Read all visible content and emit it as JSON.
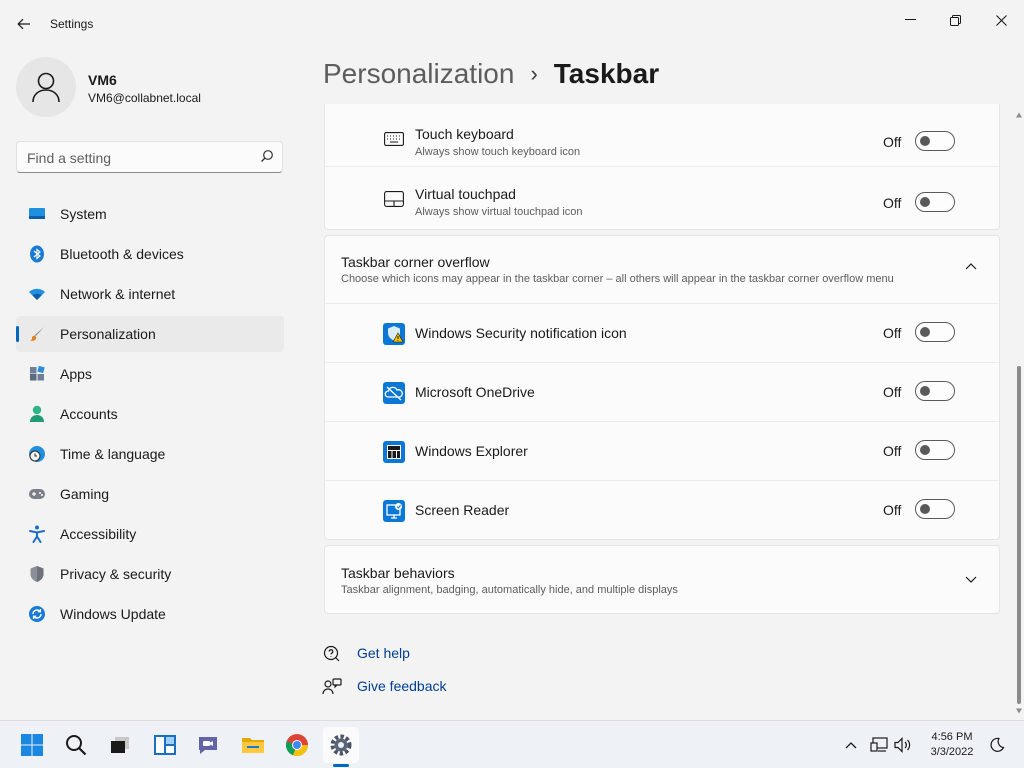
{
  "window": {
    "app_title": "Settings",
    "controls": [
      "minimize",
      "restore",
      "close"
    ]
  },
  "profile": {
    "name": "VM6",
    "email": "VM6@collabnet.local"
  },
  "search": {
    "placeholder": "Find a setting"
  },
  "sidebar": {
    "items": [
      {
        "label": "System",
        "icon": "system-icon"
      },
      {
        "label": "Bluetooth & devices",
        "icon": "bluetooth-icon"
      },
      {
        "label": "Network & internet",
        "icon": "wifi-icon"
      },
      {
        "label": "Personalization",
        "icon": "brush-icon",
        "active": true
      },
      {
        "label": "Apps",
        "icon": "apps-icon"
      },
      {
        "label": "Accounts",
        "icon": "accounts-icon"
      },
      {
        "label": "Time & language",
        "icon": "clock-globe-icon"
      },
      {
        "label": "Gaming",
        "icon": "gamepad-icon"
      },
      {
        "label": "Accessibility",
        "icon": "accessibility-icon"
      },
      {
        "label": "Privacy & security",
        "icon": "shield-icon"
      },
      {
        "label": "Windows Update",
        "icon": "update-icon"
      }
    ]
  },
  "header": {
    "parent": "Personalization",
    "separator": "›",
    "current": "Taskbar"
  },
  "pen_rows": [
    {
      "title": "Touch keyboard",
      "subtitle": "Always show touch keyboard icon",
      "state": "Off"
    },
    {
      "title": "Virtual touchpad",
      "subtitle": "Always show virtual touchpad icon",
      "state": "Off"
    }
  ],
  "overflow": {
    "title": "Taskbar corner overflow",
    "subtitle": "Choose which icons may appear in the taskbar corner – all others will appear in the taskbar corner overflow menu",
    "expanded": true,
    "rows": [
      {
        "title": "Windows Security notification icon",
        "state": "Off"
      },
      {
        "title": "Microsoft OneDrive",
        "state": "Off"
      },
      {
        "title": "Windows Explorer",
        "state": "Off"
      },
      {
        "title": "Screen Reader",
        "state": "Off"
      }
    ]
  },
  "behaviors": {
    "title": "Taskbar behaviors",
    "subtitle": "Taskbar alignment, badging, automatically hide, and multiple displays",
    "expanded": false
  },
  "links": {
    "help": "Get help",
    "feedback": "Give feedback"
  },
  "taskbar": {
    "apps": [
      "start",
      "search",
      "task-view",
      "widgets",
      "teams-chat",
      "file-explorer",
      "chrome",
      "settings"
    ],
    "active": "settings"
  },
  "clock": {
    "time": "4:56 PM",
    "date": "3/3/2022"
  },
  "colors": {
    "accent": "#0067c0",
    "background": "#f3f3f3",
    "card": "#fbfbfb",
    "link": "#003e92"
  }
}
